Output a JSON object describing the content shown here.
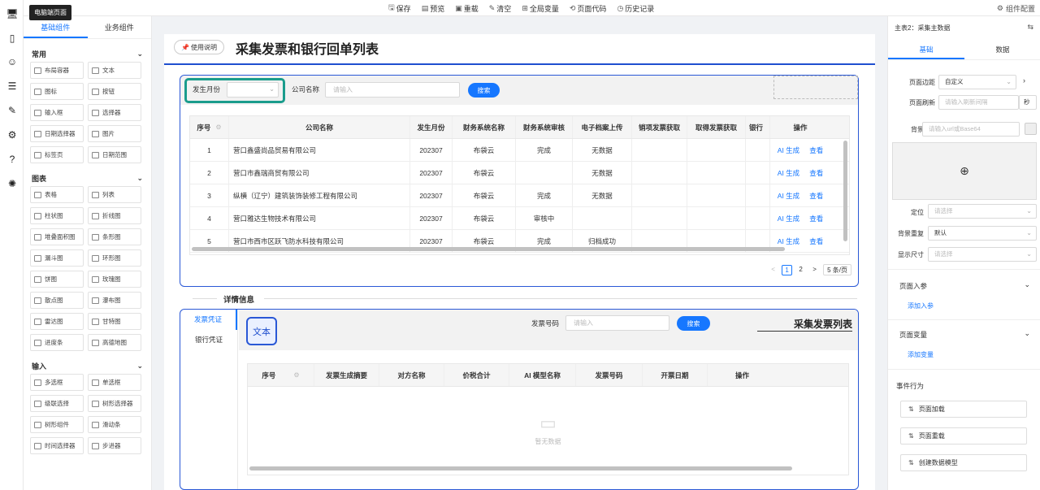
{
  "toolbar": {
    "items": [
      {
        "icon": "save-icon",
        "glyph": "🖫",
        "label": "保存"
      },
      {
        "icon": "preview-icon",
        "glyph": "▤",
        "label": "预览"
      },
      {
        "icon": "reload-icon",
        "glyph": "▣",
        "label": "重载"
      },
      {
        "icon": "clear-icon",
        "glyph": "✎",
        "label": "清空"
      },
      {
        "icon": "global-var-icon",
        "glyph": "⊞",
        "label": "全局变量"
      },
      {
        "icon": "code-icon",
        "glyph": "⟲",
        "label": "页面代码"
      },
      {
        "icon": "history-icon",
        "glyph": "◷",
        "label": "历史记录"
      }
    ],
    "config_label": "组件配置"
  },
  "tooltip": "电脑端页面",
  "left_panel": {
    "tabs": [
      "基础组件",
      "业务组件"
    ],
    "sections": [
      {
        "title": "常用",
        "items": [
          "布局容器",
          "文本",
          "图标",
          "按钮",
          "输入框",
          "选择器",
          "日期选择器",
          "图片",
          "标签页",
          "日期范围"
        ]
      },
      {
        "title": "图表",
        "items": [
          "表格",
          "列表",
          "柱状图",
          "折线图",
          "堆叠面积图",
          "条形图",
          "漏斗图",
          "环形图",
          "饼图",
          "玫瑰图",
          "散点图",
          "瀑布图",
          "雷达图",
          "甘特图",
          "进度条",
          "高德地图"
        ]
      },
      {
        "title": "输入",
        "items": [
          "多选框",
          "单选框",
          "级联选择",
          "树形选择器",
          "树形组件",
          "滑动条",
          "时间选择器",
          "步进器"
        ]
      }
    ]
  },
  "page": {
    "use_button": "使用说明",
    "title": "采集发票和银行回单列表",
    "filter": {
      "month_label": "发生月份",
      "company_label": "公司名称",
      "company_placeholder": "请输入",
      "search_label": "搜索"
    },
    "table": {
      "columns": [
        "序号",
        "公司名称",
        "发生月份",
        "财务系统名称",
        "财务系统审核",
        "电子档案上传",
        "销项发票获取",
        "取得发票获取",
        "银行",
        "操作"
      ],
      "rows": [
        {
          "no": "1",
          "company": "营口鑫盛尚品贸易有限公司",
          "month": "202307",
          "system": "布袋云",
          "audit": "完成",
          "archive": "无数据",
          "sales": "",
          "purchase": ""
        },
        {
          "no": "2",
          "company": "营口市鑫瑞商贸有限公司",
          "month": "202307",
          "system": "布袋云",
          "audit": "",
          "archive": "无数据",
          "sales": "",
          "purchase": ""
        },
        {
          "no": "3",
          "company": "纵横（辽宁）建筑装饰装修工程有限公司",
          "month": "202307",
          "system": "布袋云",
          "audit": "完成",
          "archive": "无数据",
          "sales": "",
          "purchase": ""
        },
        {
          "no": "4",
          "company": "营口雅达生物技术有限公司",
          "month": "202307",
          "system": "布袋云",
          "audit": "审核中",
          "archive": "",
          "sales": "",
          "purchase": ""
        },
        {
          "no": "5",
          "company": "营口市西市区跃飞防水科技有限公司",
          "month": "202307",
          "system": "布袋云",
          "audit": "完成",
          "archive": "归档成功",
          "sales": "",
          "purchase": ""
        }
      ],
      "action_ai": "AI 生成",
      "action_view": "查看"
    },
    "pagination": {
      "prev": "<",
      "pages": [
        "1",
        "2"
      ],
      "next": ">",
      "page_size": "5 条/页"
    },
    "detail_label": "详情信息",
    "detail": {
      "tabs": [
        "发票凭证",
        "银行凭证"
      ],
      "text_badge": "文本",
      "invoice_label": "发票号码",
      "invoice_placeholder": "请输入",
      "search_label": "搜索",
      "subtitle": "采集发票列表",
      "columns": [
        "序号",
        "发票生成摘要",
        "对方名称",
        "价税合计",
        "AI 模型名称",
        "发票号码",
        "开票日期",
        "操作"
      ],
      "empty_text": "暂无数据"
    }
  },
  "right_panel": {
    "title": "主表2：采集主数据",
    "tabs": [
      "基础",
      "数据"
    ],
    "margin_label": "页面边距",
    "margin_value": "自定义",
    "refresh_label": "页面刷新",
    "refresh_placeholder": "请输入刷新间隔",
    "refresh_unit": "秒",
    "bg_label": "背景",
    "bg_placeholder": "请输入url或Base64",
    "position_label": "定位",
    "position_placeholder": "请选择",
    "repeat_label": "背景重复",
    "repeat_value": "默认",
    "size_label": "显示尺寸",
    "size_placeholder": "请选择",
    "params_title": "页面入参",
    "params_link": "添加入参",
    "vars_title": "页面变量",
    "vars_link": "添加变量",
    "events_title": "事件行为",
    "events": [
      "页面加载",
      "页面重载",
      "创建数据模型"
    ]
  }
}
